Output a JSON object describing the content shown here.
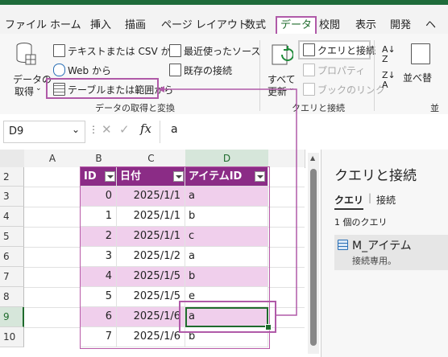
{
  "tabs": [
    {
      "label": "ファイル"
    },
    {
      "label": "ホーム"
    },
    {
      "label": "挿入"
    },
    {
      "label": "描画"
    },
    {
      "label": "ページ レイアウト"
    },
    {
      "label": "数式"
    },
    {
      "label": "データ"
    },
    {
      "label": "校閲"
    },
    {
      "label": "表示"
    },
    {
      "label": "開発"
    },
    {
      "label": "ヘ"
    }
  ],
  "ribbon": {
    "get_data_line1": "データの",
    "get_data_line2": "取得",
    "from_text_csv": "テキストまたは CSV から",
    "from_web": "Web から",
    "from_table_range": "テーブルまたは範囲から",
    "recent_sources": "最近使ったソース",
    "existing_connections": "既存の接続",
    "group_get_transform": "データの取得と変換",
    "refresh_all_line1": "すべて",
    "refresh_all_line2": "更新",
    "queries_connections": "クエリと接続",
    "properties": "プロパティ",
    "edit_links": "ブックのリンク",
    "group_queries": "クエリと接続",
    "sort_label": "並べ替",
    "group_sort_cut": "並"
  },
  "formula_bar": {
    "name_box": "D9",
    "value": "a",
    "fx": "fx"
  },
  "sheet": {
    "columns": [
      "A",
      "B",
      "C",
      "D"
    ],
    "rows": [
      "2",
      "3",
      "4",
      "5",
      "6",
      "7",
      "8",
      "9",
      "10"
    ],
    "table_headers": [
      "ID",
      "日付",
      "アイテムID"
    ],
    "table_rows": [
      {
        "id": "0",
        "date": "2025/1/1",
        "item": "a"
      },
      {
        "id": "1",
        "date": "2025/1/1",
        "item": "b"
      },
      {
        "id": "2",
        "date": "2025/1/1",
        "item": "c"
      },
      {
        "id": "3",
        "date": "2025/1/2",
        "item": "a"
      },
      {
        "id": "4",
        "date": "2025/1/5",
        "item": "b"
      },
      {
        "id": "5",
        "date": "2025/1/5",
        "item": "e"
      },
      {
        "id": "6",
        "date": "2025/1/6",
        "item": "a"
      },
      {
        "id": "7",
        "date": "2025/1/6",
        "item": "b"
      }
    ]
  },
  "panel": {
    "title": "クエリと接続",
    "tab_queries": "クエリ",
    "tab_connections": "接続",
    "query_count": "1 個のクエリ",
    "query_name": "M_アイテム",
    "query_desc": "接続専用。"
  },
  "colors": {
    "accent": "#1f6b2d",
    "highlight": "#b05aa8",
    "table_header": "#8b2c86",
    "table_band": "#f0cfec"
  }
}
